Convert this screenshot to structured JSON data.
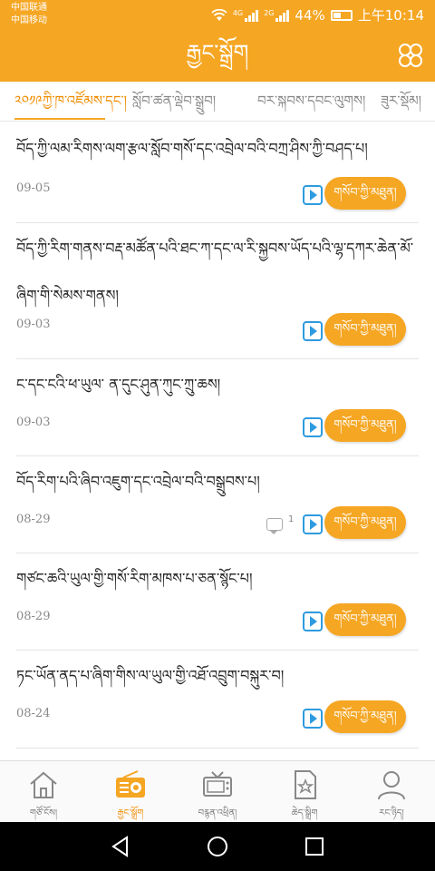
{
  "status_bar": {
    "carrier_1": "中国联通",
    "carrier_2": "中国移动",
    "net_1": "4G",
    "net_2": "2G",
    "battery_percent": "44%",
    "time": "上午10:14"
  },
  "header": {
    "title": "རྒྱང་སྒྲོག",
    "menu_icon": "four-petal-grid-icon"
  },
  "tabs": [
    {
      "label": "༢༠༡༩ཀྱི་ཁ་འཛོམས་དང་།",
      "active": true
    },
    {
      "label": "སློབ་ཚན་ལྡེབ་སྒྲུབ།",
      "active": false
    },
    {
      "label": "བར་སྐབས་དབང་ལུགས།",
      "active": false
    },
    {
      "label": "ཟུར་སྡོམ།",
      "active": false
    }
  ],
  "list": [
    {
      "title": "བོད་ཀྱི་ལམ་རིགས་ལག་རྩལ་སློབ་གསོ་དང་འབྲེལ་བའི་བཀྲ་ཤིས་ཀྱི་བཤད་པ།",
      "date": "09-05",
      "button": "གསོབ་ཀྱི་མཐུན།",
      "comments": null
    },
    {
      "title": "བོད་ཀྱི་རིག་གནས་བརྡ་མཚོན་པའི་ཐང་ཀ་དང་ལ་རི་སྐྱབས་ཡོད་པའི་ལྷ་དཀར་ཆེན་མོ་ཞིག་གི་སེམས་གནས།",
      "date": "09-03",
      "button": "གསོབ་ཀྱི་མཐུན།",
      "comments": null
    },
    {
      "title": "ང་དང་ངའི་ཕ་ཡུལ་ ན་དུང་ཤུན་ཀུང་ཀྲུ་ཆས།",
      "date": "09-03",
      "button": "གསོབ་ཀྱི་མཐུན།",
      "comments": null
    },
    {
      "title": "བོད་རིག་པའི་ཞིབ་འཇུག་དང་འབྲེལ་བའི་བསྒྲུབས་པ།",
      "date": "08-29",
      "button": "གསོབ་ཀྱི་མཐུན།",
      "comments": "1"
    },
    {
      "title": "གཙང་ཆའི་ཡུལ་གྱི་གསོ་རིག་མཁས་པ་ཅན་སྙོང་པ།",
      "date": "08-29",
      "button": "གསོབ་ཀྱི་མཐུན།",
      "comments": null
    },
    {
      "title": "ཏང་ཡོན་ནད་པ་ཞིག་གིས་ལ་ཡུལ་གྱི་འཐོ་འབྲུག་བསྐུར་བ།",
      "date": "08-24",
      "button": "གསོབ་ཀྱི་མཐུན།",
      "comments": null
    }
  ],
  "bottom_nav": [
    {
      "label": "གཙོ་ངོས།",
      "icon": "home-icon",
      "active": false
    },
    {
      "label": "རྒྱང་སྒྲོག",
      "icon": "radio-icon",
      "active": true
    },
    {
      "label": "བརྙན་འཕྲིན།",
      "icon": "tv-icon",
      "active": false
    },
    {
      "label": "ཆེད་སྒྲིག",
      "icon": "star-document-icon",
      "active": false
    },
    {
      "label": "རང་ཉིད།",
      "icon": "user-icon",
      "active": false
    }
  ],
  "colors": {
    "brand": "#f5a623",
    "active_text": "#f08c00",
    "play_icon": "#2e9be0"
  }
}
